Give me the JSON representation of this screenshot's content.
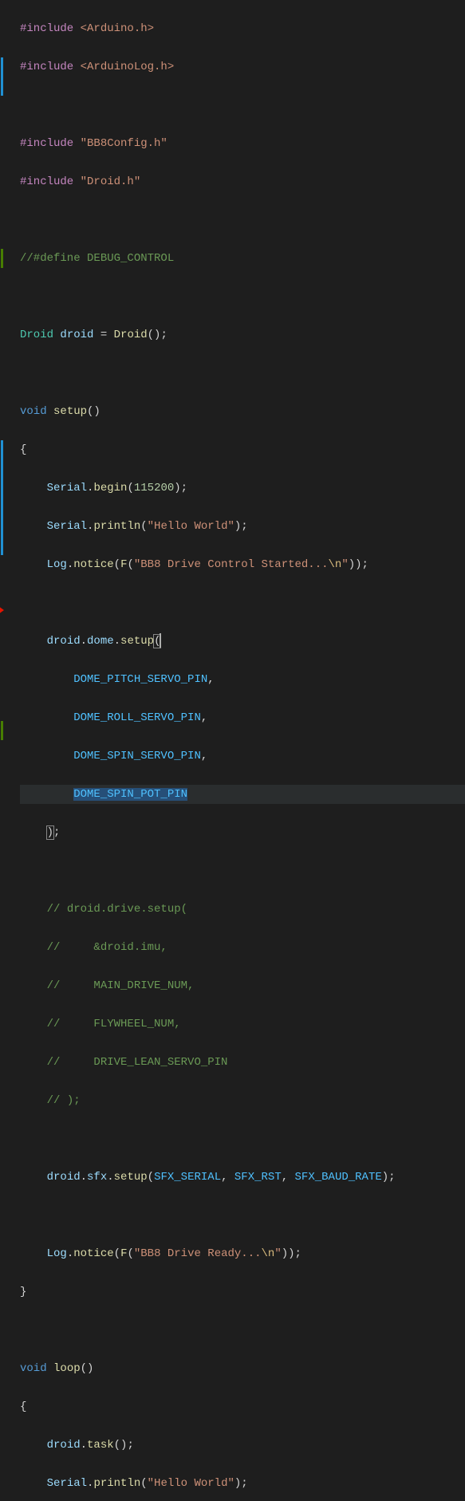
{
  "code": {
    "include1_kw": "#include",
    "include1_val": " <Arduino.h>",
    "include2_kw": "#include",
    "include2_val": " <ArduinoLog.h>",
    "include3_kw": "#include",
    "include3_val": " \"BB8Config.h\"",
    "include4_kw": "#include",
    "include4_val": " \"Droid.h\"",
    "comment_define": "//#define DEBUG_CONTROL",
    "droid_type": "Droid",
    "droid_var": " droid ",
    "droid_eq": "= ",
    "droid_ctor": "Droid",
    "droid_end": "();",
    "void_kw": "void",
    "setup_fn": " setup",
    "setup_parens": "()",
    "brace_open": "{",
    "brace_close": "}",
    "serial_begin_obj": "Serial",
    "serial_begin_dot": ".",
    "serial_begin_fn": "begin",
    "serial_begin_open": "(",
    "serial_begin_num": "115200",
    "serial_begin_close": ");",
    "serial_println_obj": "Serial",
    "serial_println_fn": "println",
    "serial_println_open": "(",
    "hello_world": "\"Hello World\"",
    "serial_println_close": ");",
    "log_obj": "Log",
    "log_fn": "notice",
    "log_open": "(",
    "f_macro": "F",
    "f_open": "(",
    "bb8_started_str_a": "\"BB8 Drive Control Started...",
    "bb8_started_esc": "\\n",
    "bb8_started_str_b": "\"",
    "f_close": "));",
    "droid_obj": "droid",
    "dome_prop": "dome",
    "setup_method": "setup",
    "const_pitch": "DOME_PITCH_SERVO_PIN",
    "const_roll": "DOME_ROLL_SERVO_PIN",
    "const_spin": "DOME_SPIN_SERVO_PIN",
    "const_pot": "DOME_SPIN_POT_PIN",
    "comma": ",",
    "close_paren_semi": ");",
    "dot": ".",
    "open_paren": "(",
    "comment_drive1": "// droid.drive.setup(",
    "comment_drive2": "//     &droid.imu,",
    "comment_drive3": "//     MAIN_DRIVE_NUM,",
    "comment_drive4": "//     FLYWHEEL_NUM,",
    "comment_drive5": "//     DRIVE_LEAN_SERVO_PIN",
    "comment_drive6": "// );",
    "sfx_prop": "sfx",
    "sfx_serial": "SFX_SERIAL",
    "sfx_rst": "SFX_RST",
    "sfx_baud": "SFX_BAUD_RATE",
    "bb8_ready_str_a": "\"BB8 Drive Ready...",
    "bb8_ready_esc": "\\n",
    "bb8_ready_str_b": "\"",
    "loop_fn": " loop",
    "loop_parens": "()",
    "task_fn": "task",
    "task_parens": "();",
    "indent1": "    ",
    "indent2": "        ",
    "comma_space": ", "
  }
}
